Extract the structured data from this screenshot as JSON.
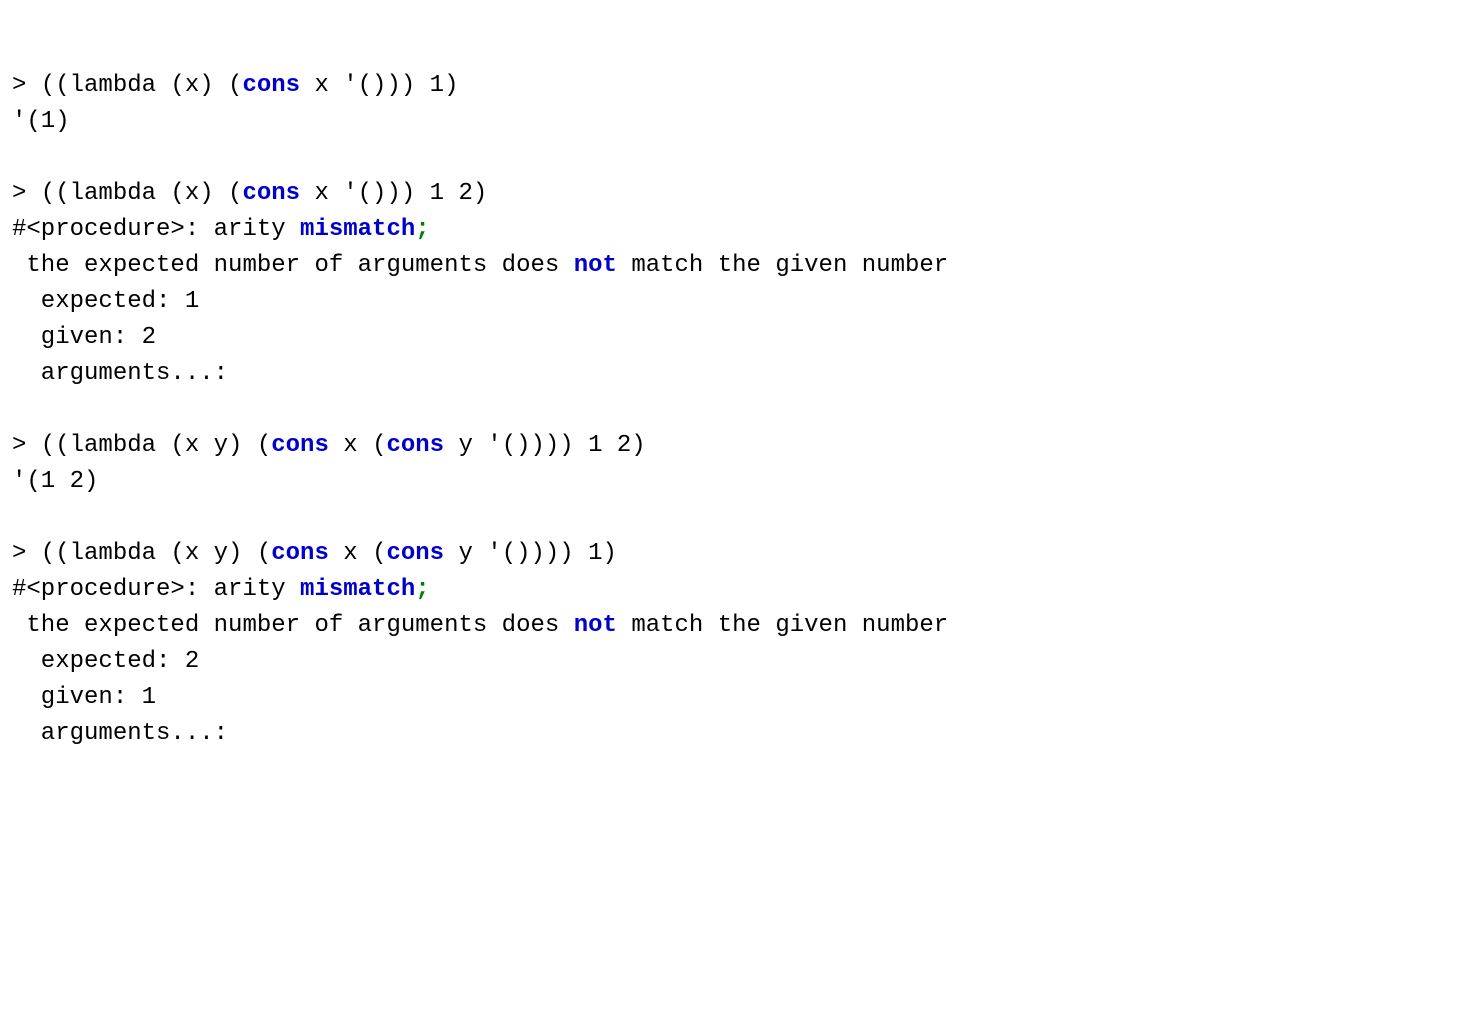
{
  "lines": [
    {
      "parts": [
        "> ((lambda (x) (",
        "cons",
        " x '())) 1)"
      ]
    },
    {
      "text": "'(1)"
    },
    {
      "text": ""
    },
    {
      "parts": [
        "> ((lambda (x) (",
        "cons",
        " x '())) 1 2)"
      ]
    },
    {
      "parts": [
        "#<procedure>: arity ",
        "mismatch",
        ";"
      ]
    },
    {
      "parts": [
        " the expected number of arguments does ",
        "not",
        " match the given number"
      ]
    },
    {
      "text": "  expected: 1"
    },
    {
      "text": "  given: 2"
    },
    {
      "text": "  arguments...:"
    },
    {
      "text": ""
    },
    {
      "parts": [
        "> ((lambda (x y) (",
        "cons",
        " x (",
        "cons",
        " y '()))) 1 2)"
      ]
    },
    {
      "text": "'(1 2)"
    },
    {
      "text": ""
    },
    {
      "parts": [
        "> ((lambda (x y) (",
        "cons",
        " x (",
        "cons",
        " y '()))) 1)"
      ]
    },
    {
      "parts": [
        "#<procedure>: arity ",
        "mismatch",
        ";"
      ]
    },
    {
      "parts": [
        " the expected number of arguments does ",
        "not",
        " match the given number"
      ]
    },
    {
      "text": "  expected: 2"
    },
    {
      "text": "  given: 1"
    },
    {
      "text": "  arguments...:"
    }
  ]
}
